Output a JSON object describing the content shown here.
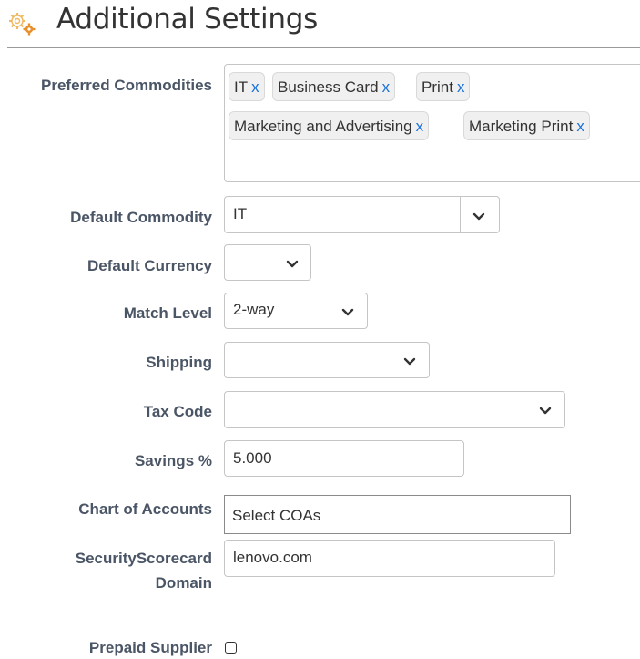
{
  "header": {
    "title": "Additional Settings",
    "icon": "gear-icon"
  },
  "fields": {
    "preferred_commodities": {
      "label": "Preferred Commodities",
      "tags": [
        "IT",
        "Business Card",
        "Print",
        "Marketing and Advertising",
        "Marketing Print"
      ],
      "remove_glyph": "x"
    },
    "default_commodity": {
      "label": "Default Commodity",
      "value": "IT"
    },
    "default_currency": {
      "label": "Default Currency",
      "value": ""
    },
    "match_level": {
      "label": "Match Level",
      "value": "2-way"
    },
    "shipping": {
      "label": "Shipping",
      "value": ""
    },
    "tax_code": {
      "label": "Tax Code",
      "value": ""
    },
    "savings": {
      "label": "Savings %",
      "value": "5.000"
    },
    "chart_of_accounts": {
      "label": "Chart of Accounts",
      "value": "Select COAs"
    },
    "security_scorecard": {
      "label_line1": "SecurityScorecard",
      "label_line2": "Domain",
      "value": "lenovo.com"
    },
    "prepaid_supplier": {
      "label": "Prepaid Supplier",
      "checked": false
    }
  },
  "colors": {
    "accent_link": "#1a73d9",
    "label_text": "#4a5566",
    "gear": "#e8a33c"
  }
}
